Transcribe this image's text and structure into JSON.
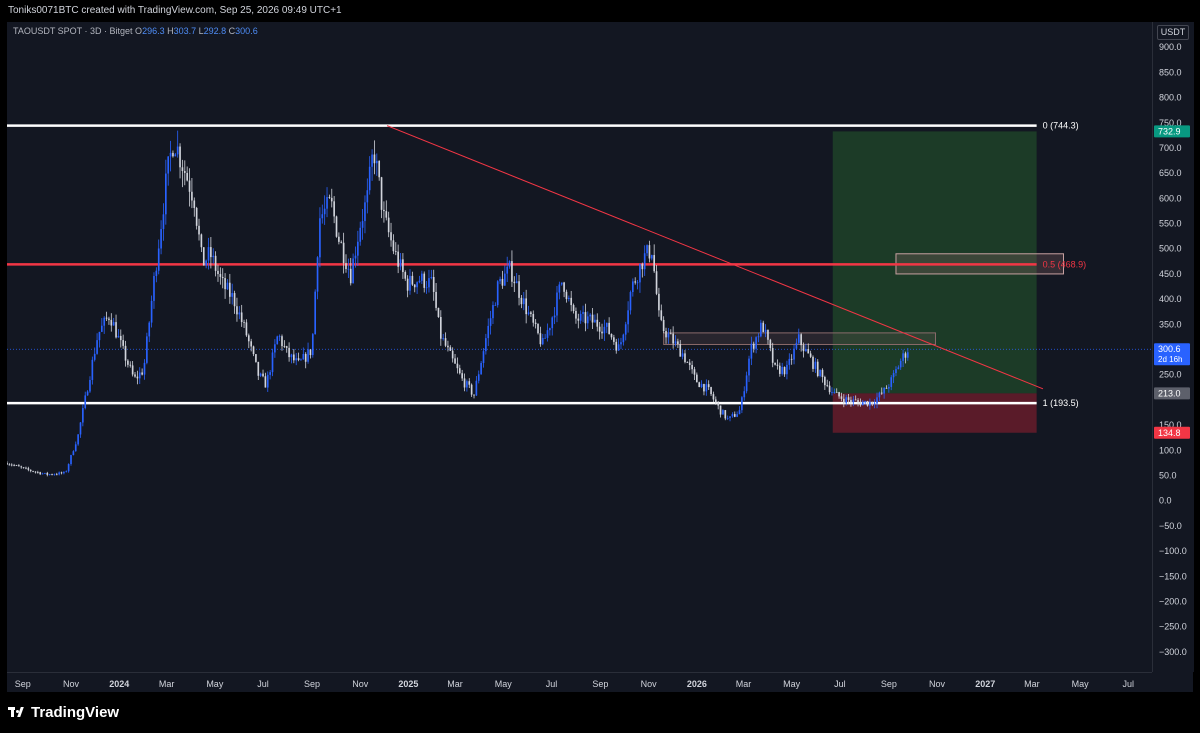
{
  "header": {
    "attribution": "Toniks0071BTC created with TradingView.com, Sep 25, 2026 09:49 UTC+1"
  },
  "legend": {
    "symbol": "TAOUSDT SPOT · 3D · Bitget",
    "ohlc": [
      {
        "k": "O",
        "v": "296.3"
      },
      {
        "k": "H",
        "v": "303.7"
      },
      {
        "k": "L",
        "v": "292.8"
      },
      {
        "k": "C",
        "v": "300.6"
      }
    ]
  },
  "price_axis": {
    "unit": "USDT"
  },
  "footer": {
    "brand": "TradingView"
  },
  "colors": {
    "background": "#131722",
    "candle_up": "#2962ff",
    "candle_down": "#d1d4dc",
    "level_line": "#ffffff",
    "mid_line": "#f23645",
    "trend_line": "#f23645",
    "profit_zone": "#1e4d2b",
    "loss_zone": "#5e1a22"
  },
  "chart_data": {
    "type": "candlestick",
    "symbol": "TAOUSDT SPOT",
    "interval": "3D",
    "exchange": "Bitget",
    "ylim": [
      -340,
      950
    ],
    "yticks": [
      {
        "v": 900,
        "label": "900.0"
      },
      {
        "v": 850,
        "label": "850.0"
      },
      {
        "v": 800,
        "label": "800.0"
      },
      {
        "v": 750,
        "label": "750.0"
      },
      {
        "v": 700,
        "label": "700.0"
      },
      {
        "v": 650,
        "label": "650.0"
      },
      {
        "v": 600,
        "label": "600.0"
      },
      {
        "v": 550,
        "label": "550.0"
      },
      {
        "v": 500,
        "label": "500.0"
      },
      {
        "v": 450,
        "label": "450.0"
      },
      {
        "v": 400,
        "label": "400.0"
      },
      {
        "v": 350,
        "label": "350.0"
      },
      {
        "v": 250,
        "label": "250.0"
      },
      {
        "v": 150,
        "label": "150.0"
      },
      {
        "v": 100,
        "label": "100.0"
      },
      {
        "v": 50,
        "label": "50.0"
      },
      {
        "v": 0,
        "label": "0.0"
      },
      {
        "v": -50,
        "label": "−50.0"
      },
      {
        "v": -100,
        "label": "−100.0"
      },
      {
        "v": -150,
        "label": "−150.0"
      },
      {
        "v": -200,
        "label": "−200.0"
      },
      {
        "v": -250,
        "label": "−250.0"
      },
      {
        "v": -300,
        "label": "−300.0"
      }
    ],
    "xlim": [
      "2023-08-12",
      "2027-07-31"
    ],
    "xticks": [
      {
        "d": "2023-09-01",
        "label": "Sep",
        "bold": false
      },
      {
        "d": "2023-11-01",
        "label": "Nov",
        "bold": false
      },
      {
        "d": "2024-01-01",
        "label": "2024",
        "bold": true
      },
      {
        "d": "2024-03-01",
        "label": "Mar",
        "bold": false
      },
      {
        "d": "2024-05-01",
        "label": "May",
        "bold": false
      },
      {
        "d": "2024-07-01",
        "label": "Jul",
        "bold": false
      },
      {
        "d": "2024-09-01",
        "label": "Sep",
        "bold": false
      },
      {
        "d": "2024-11-01",
        "label": "Nov",
        "bold": false
      },
      {
        "d": "2025-01-01",
        "label": "2025",
        "bold": true
      },
      {
        "d": "2025-03-01",
        "label": "Mar",
        "bold": false
      },
      {
        "d": "2025-05-01",
        "label": "May",
        "bold": false
      },
      {
        "d": "2025-07-01",
        "label": "Jul",
        "bold": false
      },
      {
        "d": "2025-09-01",
        "label": "Sep",
        "bold": false
      },
      {
        "d": "2025-11-01",
        "label": "Nov",
        "bold": false
      },
      {
        "d": "2026-01-01",
        "label": "2026",
        "bold": true
      },
      {
        "d": "2026-03-01",
        "label": "Mar",
        "bold": false
      },
      {
        "d": "2026-05-01",
        "label": "May",
        "bold": false
      },
      {
        "d": "2026-07-01",
        "label": "Jul",
        "bold": false
      },
      {
        "d": "2026-09-01",
        "label": "Sep",
        "bold": false
      },
      {
        "d": "2026-11-01",
        "label": "Nov",
        "bold": false
      },
      {
        "d": "2027-01-01",
        "label": "2027",
        "bold": true
      },
      {
        "d": "2027-03-01",
        "label": "Mar",
        "bold": false
      },
      {
        "d": "2027-05-01",
        "label": "May",
        "bold": false
      },
      {
        "d": "2027-07-01",
        "label": "Jul",
        "bold": false
      }
    ],
    "price_path": [
      [
        "2023-08-12",
        75
      ],
      [
        "2023-09-05",
        62
      ],
      [
        "2023-10-01",
        52
      ],
      [
        "2023-10-25",
        55
      ],
      [
        "2023-11-10",
        130
      ],
      [
        "2023-11-20",
        210
      ],
      [
        "2023-12-05",
        330
      ],
      [
        "2023-12-20",
        370
      ],
      [
        "2024-01-05",
        300
      ],
      [
        "2024-01-20",
        240
      ],
      [
        "2024-02-01",
        260
      ],
      [
        "2024-02-15",
        450
      ],
      [
        "2024-03-01",
        640
      ],
      [
        "2024-03-10",
        720
      ],
      [
        "2024-03-25",
        650
      ],
      [
        "2024-04-05",
        600
      ],
      [
        "2024-04-15",
        470
      ],
      [
        "2024-04-25",
        490
      ],
      [
        "2024-05-10",
        430
      ],
      [
        "2024-05-25",
        400
      ],
      [
        "2024-06-10",
        330
      ],
      [
        "2024-06-25",
        250
      ],
      [
        "2024-07-05",
        230
      ],
      [
        "2024-07-20",
        330
      ],
      [
        "2024-08-01",
        290
      ],
      [
        "2024-08-15",
        270
      ],
      [
        "2024-09-01",
        300
      ],
      [
        "2024-09-10",
        560
      ],
      [
        "2024-09-25",
        590
      ],
      [
        "2024-10-05",
        520
      ],
      [
        "2024-10-20",
        450
      ],
      [
        "2024-11-01",
        550
      ],
      [
        "2024-11-10",
        600
      ],
      [
        "2024-11-18",
        700
      ],
      [
        "2024-12-01",
        560
      ],
      [
        "2024-12-15",
        490
      ],
      [
        "2024-12-30",
        430
      ],
      [
        "2025-01-15",
        440
      ],
      [
        "2025-01-31",
        430
      ],
      [
        "2025-02-10",
        330
      ],
      [
        "2025-02-25",
        280
      ],
      [
        "2025-03-10",
        240
      ],
      [
        "2025-03-25",
        210
      ],
      [
        "2025-04-10",
        330
      ],
      [
        "2025-04-25",
        430
      ],
      [
        "2025-05-10",
        460
      ],
      [
        "2025-05-25",
        400
      ],
      [
        "2025-06-10",
        340
      ],
      [
        "2025-06-20",
        310
      ],
      [
        "2025-07-01",
        360
      ],
      [
        "2025-07-15",
        440
      ],
      [
        "2025-07-30",
        360
      ],
      [
        "2025-08-15",
        360
      ],
      [
        "2025-08-30",
        350
      ],
      [
        "2025-09-10",
        340
      ],
      [
        "2025-09-25",
        300
      ],
      [
        "2025-10-10",
        420
      ],
      [
        "2025-10-25",
        480
      ],
      [
        "2025-11-05",
        500
      ],
      [
        "2025-11-15",
        350
      ],
      [
        "2025-11-30",
        320
      ],
      [
        "2025-12-15",
        290
      ],
      [
        "2025-12-30",
        240
      ],
      [
        "2026-01-15",
        220
      ],
      [
        "2026-01-30",
        180
      ],
      [
        "2026-02-10",
        160
      ],
      [
        "2026-02-25",
        180
      ],
      [
        "2026-03-10",
        300
      ],
      [
        "2026-03-25",
        350
      ],
      [
        "2026-04-10",
        260
      ],
      [
        "2026-04-25",
        260
      ],
      [
        "2026-05-10",
        320
      ],
      [
        "2026-05-25",
        280
      ],
      [
        "2026-06-10",
        240
      ],
      [
        "2026-06-25",
        210
      ],
      [
        "2026-07-10",
        200
      ],
      [
        "2026-07-25",
        195
      ],
      [
        "2026-08-10",
        195
      ],
      [
        "2026-08-25",
        215
      ],
      [
        "2026-09-05",
        240
      ],
      [
        "2026-09-15",
        275
      ],
      [
        "2026-09-25",
        300.6
      ]
    ],
    "horizontal_levels": [
      {
        "value": 744.3,
        "label": "0 (744.3)",
        "color": "#ffffff",
        "x_start": "2023-08-12",
        "x_end": "2027-03-07"
      },
      {
        "value": 468.9,
        "label": "0.5 (468.9)",
        "color": "#f23645",
        "x_start": "2023-08-12",
        "x_end": "2027-03-07"
      },
      {
        "value": 193.5,
        "label": "1 (193.5)",
        "color": "#ffffff",
        "x_start": "2023-08-12",
        "x_end": "2027-03-07"
      }
    ],
    "trend_line": {
      "from": [
        "2024-12-05",
        744.3
      ],
      "to": [
        "2027-03-15",
        222
      ],
      "color": "#f23645"
    },
    "last_price_line": {
      "value": 300.6
    },
    "rectangles": [
      {
        "name": "resistance-box",
        "x0": "2025-11-20",
        "x1": "2026-10-30",
        "y0": 310,
        "y1": 333,
        "stroke": "#8a6a6a",
        "fill": "rgba(120,90,90,0.22)"
      },
      {
        "name": "target-box",
        "x0": "2026-09-10",
        "x1": "2027-04-10",
        "y0": 450,
        "y1": 490,
        "stroke": "#c7a0a0",
        "fill": "rgba(140,100,100,0.28)"
      }
    ],
    "position": {
      "x0": "2026-06-22",
      "x1": "2027-03-07",
      "entry": 213.0,
      "target": 732.9,
      "stop": 134.8,
      "profit_fill": "rgba(46,125,50,0.35)",
      "loss_fill": "rgba(178,34,52,0.45)",
      "entry_label": "213.0",
      "target_label": "732.9",
      "stop_label": "134.8"
    },
    "price_tags": [
      {
        "name": "target-price-tag",
        "value": 732.9,
        "label": "732.9",
        "bg": "#089981",
        "fg": "#ffffff"
      },
      {
        "name": "last-price-tag",
        "value": 300.6,
        "label": "300.6",
        "sub": "2d 16h",
        "bg": "#2962ff",
        "fg": "#ffffff"
      },
      {
        "name": "entry-price-tag",
        "value": 213.0,
        "label": "213.0",
        "bg": "#5d606b",
        "fg": "#ffffff"
      },
      {
        "name": "stop-price-tag",
        "value": 134.8,
        "label": "134.8",
        "bg": "#f23645",
        "fg": "#ffffff"
      }
    ]
  }
}
